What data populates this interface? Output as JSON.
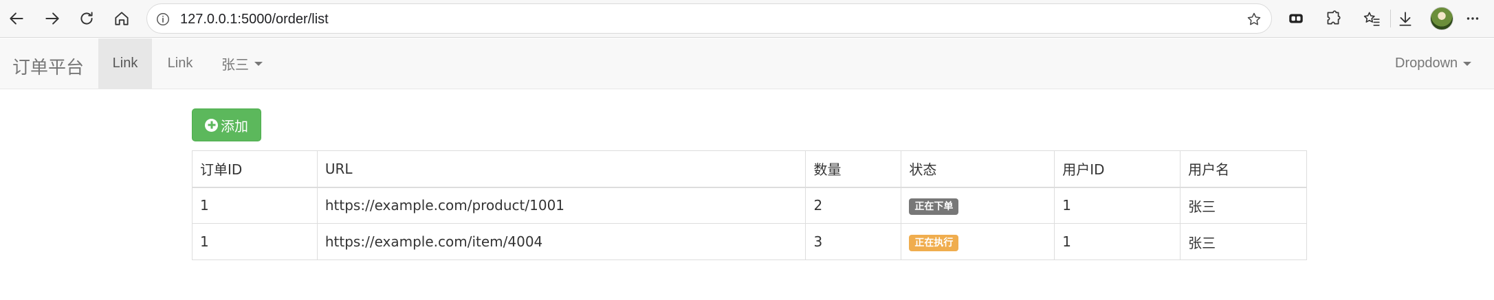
{
  "browser": {
    "url": "127.0.0.1:5000/order/list"
  },
  "navbar": {
    "brand": "订单平台",
    "links": [
      "Link",
      "Link"
    ],
    "user_dropdown": "张三",
    "right_dropdown": "Dropdown"
  },
  "actions": {
    "add_label": "添加"
  },
  "table": {
    "headers": [
      "订单ID",
      "URL",
      "数量",
      "状态",
      "用户ID",
      "用户名"
    ],
    "rows": [
      {
        "order_id": "1",
        "url": "https://example.com/product/1001",
        "quantity": "2",
        "status": "正在下单",
        "status_color": "#777777",
        "user_id": "1",
        "username": "张三"
      },
      {
        "order_id": "1",
        "url": "https://example.com/item/4004",
        "quantity": "3",
        "status": "正在执行",
        "status_color": "#f0ad4e",
        "user_id": "1",
        "username": "张三"
      }
    ]
  },
  "colors": {
    "accent_green": "#5cb85c",
    "navbar_bg": "#f8f8f8"
  },
  "icons": [
    "back-arrow-icon",
    "forward-arrow-icon",
    "refresh-icon",
    "home-icon",
    "info-icon",
    "favorite-star-icon",
    "extension-icon",
    "puzzle-icon",
    "favorites-icon",
    "download-icon",
    "more-icon",
    "plus-circle-icon"
  ]
}
